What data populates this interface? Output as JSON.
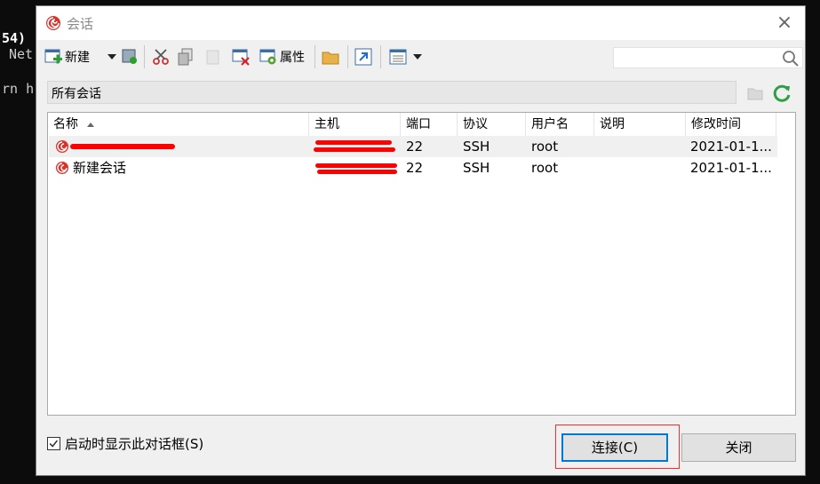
{
  "terminal": {
    "lines": [
      "54)",
      "Net",
      "rn h"
    ]
  },
  "dialog": {
    "title": "会话",
    "close_glyph": "×",
    "toolbar": {
      "new_label": "新建",
      "properties_label": "属性",
      "search_placeholder": ""
    },
    "path": "所有会话",
    "columns": [
      "名称",
      "主机",
      "端口",
      "协议",
      "用户名",
      "说明",
      "修改时间"
    ],
    "rows": [
      {
        "name": "",
        "host": "...",
        "port": "22",
        "protocol": "SSH",
        "user": "root",
        "desc": "",
        "modified": "2021-01-1...",
        "selected": true
      },
      {
        "name": "新建会话",
        "host": "",
        "port": "22",
        "protocol": "SSH",
        "user": "root",
        "desc": "",
        "modified": "2021-01-1...",
        "selected": false
      }
    ],
    "footer": {
      "show_dialog_label": "启动时显示此对话框(S)",
      "show_dialog_checked": true,
      "connect_label": "连接(C)",
      "close_label": "关闭"
    }
  },
  "colors": {
    "accent": "#0078d7",
    "redaction": "#ff0000",
    "highlight": "#ff2a2a",
    "selected_row": "#f0f0f0"
  }
}
